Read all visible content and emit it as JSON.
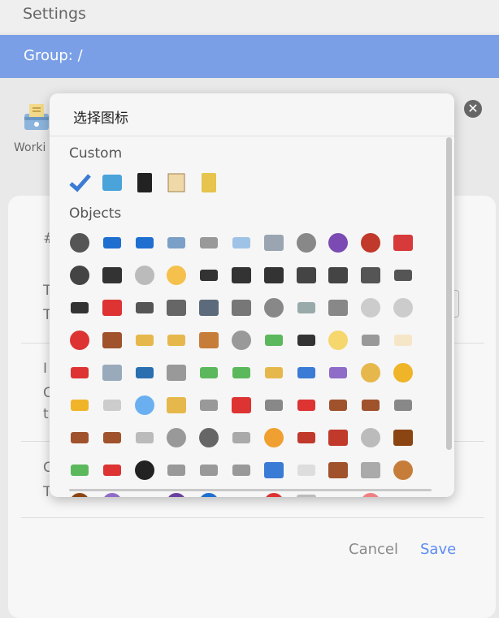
{
  "app": {
    "title": "Settings",
    "group_label": "Group: /"
  },
  "background": {
    "left_label": "Worki",
    "row1": "#",
    "row2a": "T",
    "row2b": "T",
    "row3a": "I",
    "row3b": "C",
    "row3c": "t",
    "row4a": "C",
    "row4b": "T",
    "cancel_label": "Cancel",
    "save_label": "Save"
  },
  "dialog": {
    "title": "选择图标",
    "sections": [
      {
        "name": "Custom",
        "icons": [
          "checkmark-icon",
          "cabinet-icon",
          "notebook-pen-icon",
          "scroll-icon",
          "open-book-icon"
        ]
      },
      {
        "name": "Objects",
        "icons": [
          "watch-icon",
          "phone-icon",
          "phone-arrow-icon",
          "laptop-icon",
          "keyboard-icon",
          "desktop-icon",
          "printer-icon",
          "mouse-icon",
          "trackball-icon",
          "joystick-icon",
          "clamp-icon",
          "minidisc-icon",
          "floppy-icon",
          "cd-icon",
          "dvd-icon",
          "vhs-icon",
          "camera-icon",
          "camera-flash-icon",
          "video-camera-icon",
          "movie-camera-icon",
          "projector-icon",
          "film-icon",
          "telephone-receiver-icon",
          "telephone-icon",
          "pager-icon",
          "fax-icon",
          "tv-icon",
          "radio-icon",
          "microphone-icon",
          "level-slider-icon",
          "control-knobs-icon",
          "stopwatch-icon",
          "timer-clock-icon",
          "alarm-clock-icon",
          "mantel-clock-icon",
          "hourglass-icon",
          "hourglass-flowing-icon",
          "abacus-icon",
          "satellite-dish-icon",
          "battery-icon",
          "plug-icon",
          "bulb-icon",
          "flashlight-icon",
          "candle-icon",
          "extinguisher-icon",
          "wastebasket-icon",
          "oil-drum-icon",
          "cart-icon",
          "money-wings-icon",
          "dollar-icon",
          "yen-icon",
          "euro-icon",
          "pound-icon",
          "moneybag-icon",
          "coin-icon",
          "credit-card-icon",
          "id-card-icon",
          "gem-icon",
          "scales-icon",
          "probe-icon",
          "toolbox-icon",
          "wrench-icon",
          "screwdriver-icon",
          "hammer-icon",
          "hammer-pick-icon",
          "hammer-wrench-icon",
          "pick-icon",
          "axe-icon",
          "saw-icon",
          "nut-bolt-icon",
          "gear-icon",
          "chains-icon",
          "hook-icon",
          "ladder-icon",
          "bricks-icon",
          "rock-icon",
          "wood-icon",
          "water-pistol-icon",
          "firecracker-icon",
          "bomb-icon",
          "knife-icon",
          "dagger-icon",
          "swords-icon",
          "shield-icon",
          "cigarette-icon",
          "coffin-icon",
          "headstone-icon",
          "urn-icon",
          "amphora-icon",
          "crystal-ball-icon",
          "magic-wand-icon",
          "prayer-beads-icon",
          "nazar-icon",
          "barber-pole-icon",
          "magnet-icon",
          "alembic-icon",
          "test-tube-icon",
          "petri-dish-icon",
          "dna-icon"
        ]
      }
    ]
  }
}
